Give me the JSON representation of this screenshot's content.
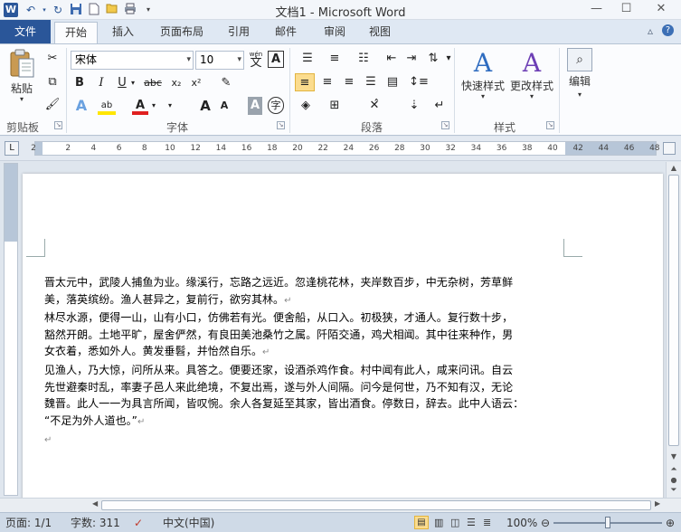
{
  "window": {
    "title": "文档1 - Microsoft Word",
    "app_icon": "W",
    "controls": {
      "minimize": "—",
      "maximize": "☐",
      "close": "✕"
    }
  },
  "quick_access": [
    "undo-icon",
    "redo-icon",
    "save-icon",
    "new-icon",
    "open-icon",
    "print-icon",
    "customize-icon"
  ],
  "tabs": [
    {
      "label": "文件",
      "kind": "file"
    },
    {
      "label": "开始",
      "active": true
    },
    {
      "label": "插入"
    },
    {
      "label": "页面布局"
    },
    {
      "label": "引用"
    },
    {
      "label": "邮件"
    },
    {
      "label": "审阅"
    },
    {
      "label": "视图"
    }
  ],
  "ribbon": {
    "clipboard": {
      "label": "剪贴板",
      "paste": "粘贴"
    },
    "font": {
      "label": "字体",
      "font_name": "宋体",
      "font_size": "10",
      "phonetic": "wén",
      "bold": "B",
      "italic": "I",
      "underline": "U",
      "strike": "abc",
      "subscript": "x₂",
      "superscript": "x²",
      "grow": "A",
      "shrink": "A",
      "char_shade": "A",
      "enclose": "字"
    },
    "paragraph": {
      "label": "段落"
    },
    "styles": {
      "label": "样式",
      "quick_styles": "快速样式",
      "change_styles": "更改样式"
    },
    "editing": {
      "label": "编辑"
    }
  },
  "ruler": {
    "ticks": [
      "2",
      "2",
      "4",
      "6",
      "8",
      "10",
      "12",
      "14",
      "16",
      "18",
      "20",
      "22",
      "24",
      "26",
      "28",
      "30",
      "32",
      "34",
      "36",
      "38",
      "40",
      "42",
      "44",
      "46",
      "48"
    ]
  },
  "document": {
    "paragraphs": [
      [
        "晋太元中，武陵人捕鱼为业。缘溪行，忘路之远近。忽逢桃花林，夹岸数百步，中无杂树，芳草鲜",
        "美，落英缤纷。渔人甚异之，复前行，欲穷其林。"
      ],
      [
        "林尽水源，便得一山，山有小口，仿佛若有光。便舍船，从口入。初极狭，才通人。复行数十步，",
        "豁然开朗。土地平旷，屋舍俨然，有良田美池桑竹之属。阡陌交通，鸡犬相闻。其中往来种作，男",
        "女衣着，悉如外人。黄发垂髫，并怡然自乐。"
      ],
      [
        "见渔人，乃大惊，问所从来。具答之。便要还家，设酒杀鸡作食。村中闻有此人，咸来问讯。自云",
        "先世避秦时乱，率妻子邑人来此绝境，不复出焉，遂与外人间隔。问今是何世，乃不知有汉，无论",
        "魏晋。此人一一为具言所闻，皆叹惋。余人各复延至其家，皆出酒食。停数日，辞去。此中人语云：",
        "“不足为外人道也。”"
      ],
      [
        ""
      ]
    ],
    "paragraph_mark": "↵"
  },
  "status": {
    "page": "页面: 1/1",
    "words": "字数: 311",
    "language": "中文(中国)",
    "zoom": "100%",
    "zoom_level": 1.0
  }
}
